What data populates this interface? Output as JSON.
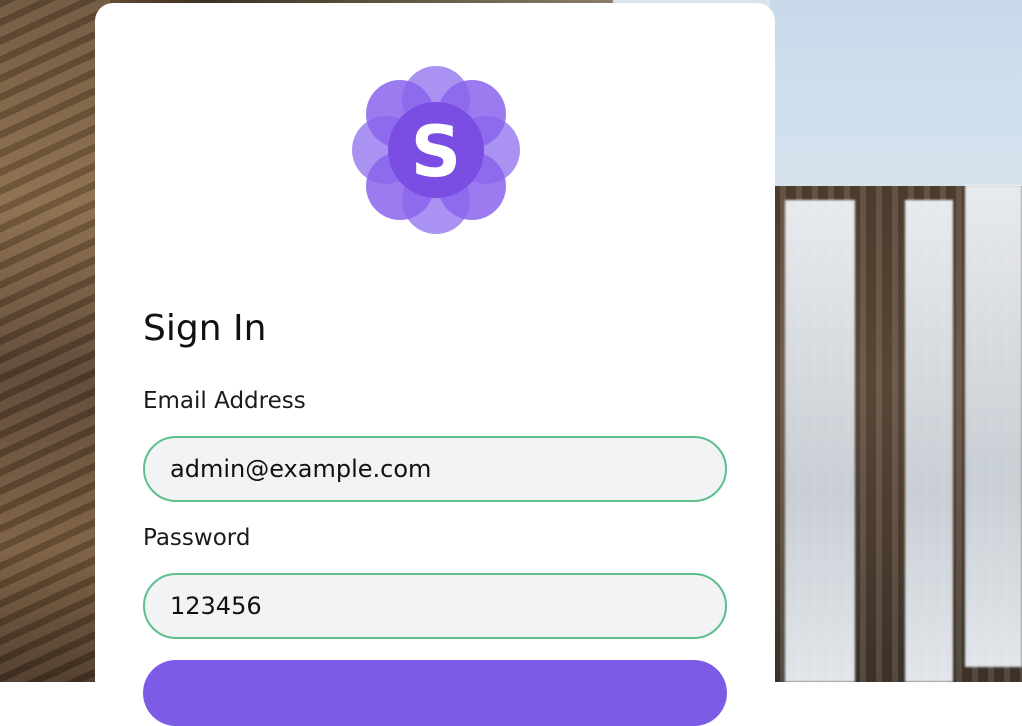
{
  "logo": {
    "letter": "S",
    "color_light": "#9b7ff0",
    "color_dark": "#7a4ee3"
  },
  "form": {
    "title": "Sign In",
    "email_label": "Email Address",
    "email_value": "admin@example.com",
    "password_label": "Password",
    "password_value": "123456"
  },
  "colors": {
    "accent": "#7c5ce6",
    "field_border": "#5fbf8c",
    "field_bg": "#f1f3f5"
  }
}
